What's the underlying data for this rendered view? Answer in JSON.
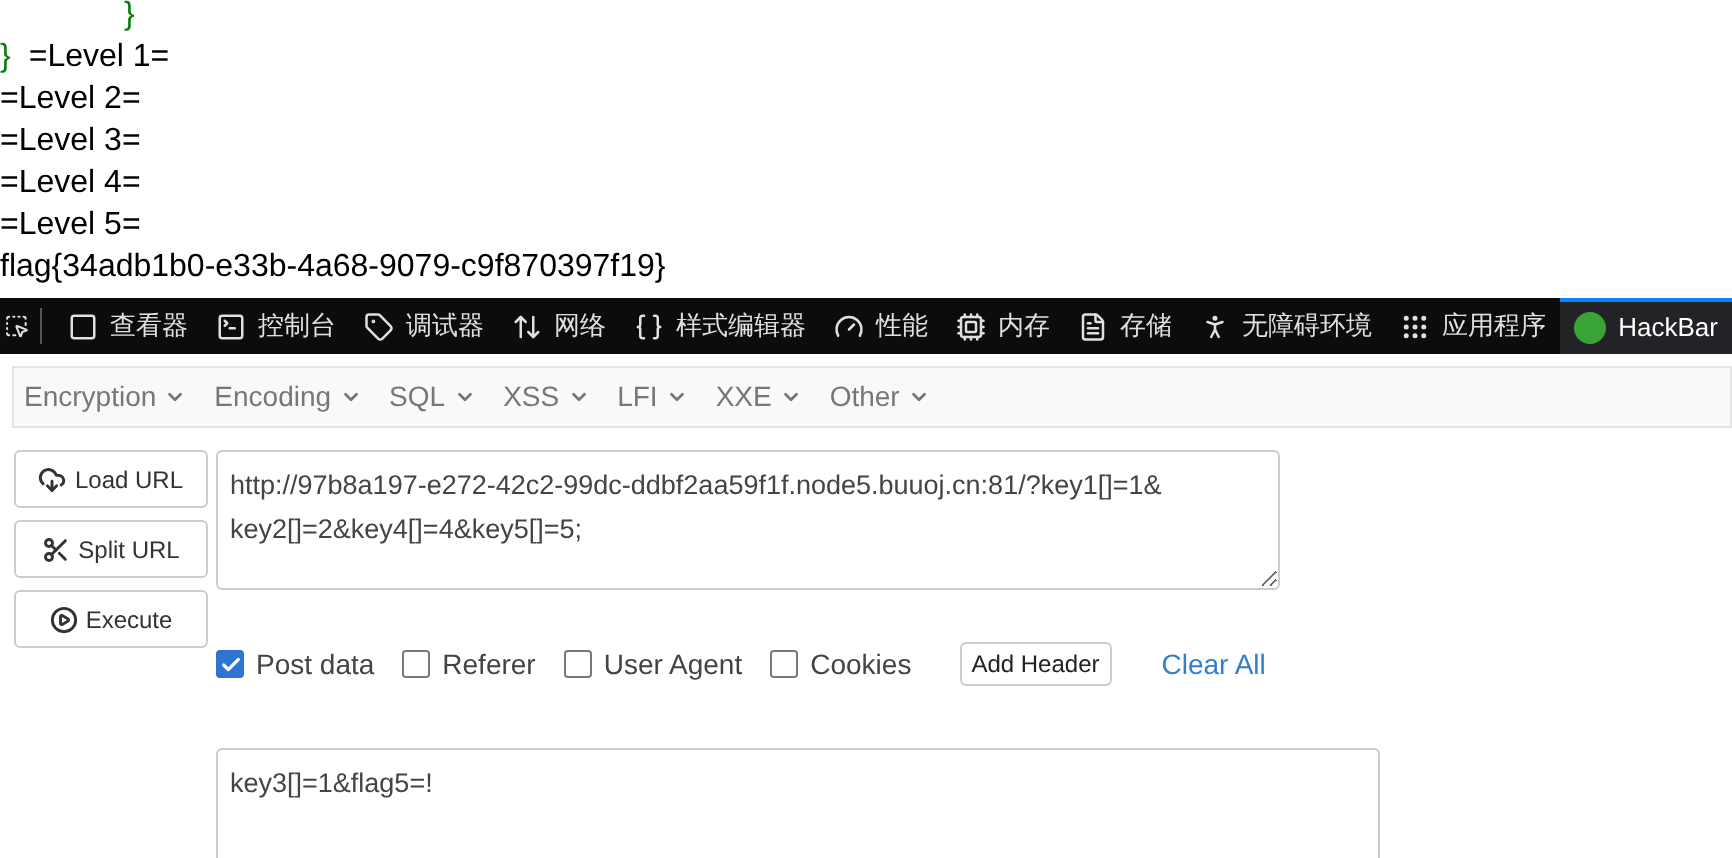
{
  "output": [
    {
      "kind": "brace",
      "text": "}"
    },
    {
      "kind": "brace_text",
      "brace": "}",
      "text": "=Level 1="
    },
    {
      "kind": "text",
      "text": "=Level 2="
    },
    {
      "kind": "text",
      "text": "=Level 3="
    },
    {
      "kind": "text",
      "text": "=Level 4="
    },
    {
      "kind": "text",
      "text": "=Level 5="
    },
    {
      "kind": "text",
      "text": "flag{34adb1b0-e33b-4a68-9079-c9f870397f19}"
    }
  ],
  "devtools_tabs": [
    {
      "label": "查看器",
      "selected": false
    },
    {
      "label": "控制台",
      "selected": false
    },
    {
      "label": "调试器",
      "selected": false
    },
    {
      "label": "网络",
      "selected": false
    },
    {
      "label": "样式编辑器",
      "selected": false
    },
    {
      "label": "性能",
      "selected": false
    },
    {
      "label": "内存",
      "selected": false
    },
    {
      "label": "存储",
      "selected": false
    },
    {
      "label": "无障碍环境",
      "selected": false
    },
    {
      "label": "应用程序",
      "selected": false
    },
    {
      "label": "HackBar",
      "selected": true
    }
  ],
  "menu": [
    "Encryption",
    "Encoding",
    "SQL",
    "XSS",
    "LFI",
    "XXE",
    "Other"
  ],
  "actions": [
    "Load URL",
    "Split URL",
    "Execute"
  ],
  "url": {
    "value": "http://97b8a197-e272-42c2-99dc-ddbf2aa59f1f.node5.buuoj.cn:81/?key1[]=1&key2[]=2&key4[]=4&key5[]=5;"
  },
  "options": [
    {
      "label": "Post data",
      "checked": true
    },
    {
      "label": "Referer",
      "checked": false
    },
    {
      "label": "User Agent",
      "checked": false
    },
    {
      "label": "Cookies",
      "checked": false
    }
  ],
  "add_header": "Add Header",
  "clear_all": "Clear All",
  "post": {
    "value": "key3[]=1&flag5=!"
  }
}
